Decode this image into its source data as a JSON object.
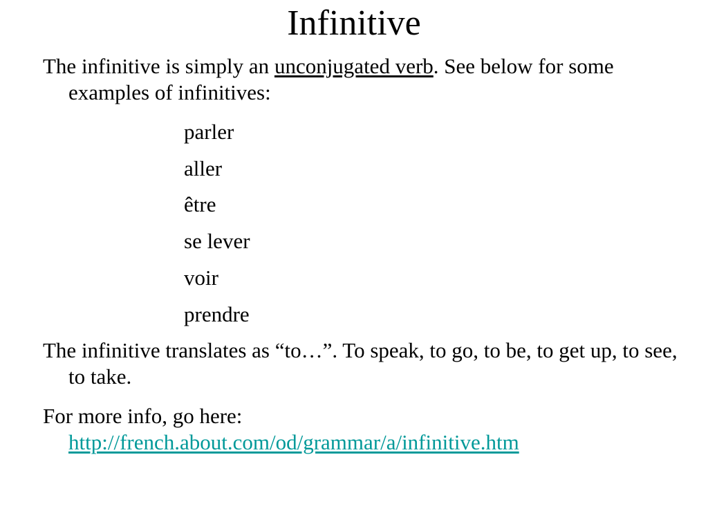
{
  "title": "Infinitive",
  "para1": {
    "before": "The infinitive is simply an ",
    "underlined": "unconjugated verb",
    "after": ".  See below for some examples of infinitives:"
  },
  "examples": [
    "parler",
    "aller",
    "être",
    "se lever",
    "voir",
    "prendre"
  ],
  "para2": "The infinitive translates as “to…”.  To speak, to go, to be, to get up, to see, to take.",
  "para3": {
    "text": "For more info, go here:",
    "link": "http://french.about.com/od/grammar/a/infinitive.htm"
  },
  "colors": {
    "link": "#009999"
  }
}
